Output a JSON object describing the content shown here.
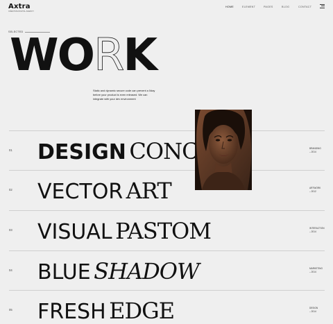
{
  "brand": {
    "name": "Axtra",
    "tagline": "CREATIVE DIGITAL AGENCY"
  },
  "nav": {
    "items": [
      "HOME",
      "ELEMENT",
      "PAGES",
      "BLOG",
      "CONTACT"
    ],
    "active": "HOME"
  },
  "hero": {
    "label": "SELECTED",
    "title_parts": [
      "WO",
      "R",
      "K"
    ],
    "description": "Static and dynamic secure code can prevent a 0day before your product is even released. We can integrate with your dev environment"
  },
  "portrait_icon": "woman-portrait",
  "projects": [
    {
      "num": "01",
      "bold": "DESIGN",
      "serif": "CONCEPT",
      "category": "BRANDING",
      "year": "– 2014"
    },
    {
      "num": "02",
      "bold": "VECTOR",
      "serif": "ART",
      "category": "ARTWORK",
      "year": "– 2012"
    },
    {
      "num": "03",
      "bold": "VISUAL",
      "serif": "PASTOM",
      "category": "INTERACTION",
      "year": "– 2014"
    },
    {
      "num": "04",
      "bold": "BLUE",
      "serif": "SHADOW",
      "category": "MARKETING",
      "year": "– 2014"
    },
    {
      "num": "05",
      "bold": "FRESH",
      "serif": "EDGE",
      "category": "DESIGN",
      "year": "– 2014"
    }
  ]
}
